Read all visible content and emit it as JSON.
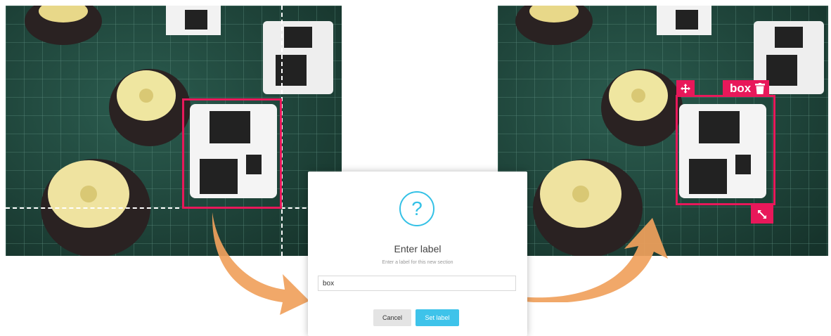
{
  "dialog": {
    "icon": "question-circle-icon",
    "title": "Enter label",
    "subtitle": "Enter a label for this new section",
    "input_value": "box",
    "cancel_label": "Cancel",
    "set_label": "Set label"
  },
  "annotation": {
    "label": "box",
    "move_icon": "move-arrows-icon",
    "delete_icon": "trash-icon",
    "resize_icon": "resize-diagonal-icon"
  },
  "colors": {
    "accent_box": "#e8185a",
    "dialog_accent": "#3ec3ea",
    "arrow": "#f0a15c",
    "mat_green": "#21493f"
  }
}
